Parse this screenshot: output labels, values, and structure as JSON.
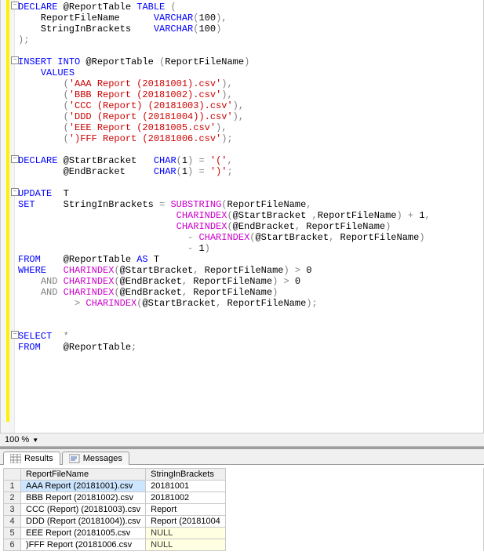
{
  "zoom": {
    "value": "100 %"
  },
  "tabs": {
    "results": "Results",
    "messages": "Messages"
  },
  "fold_glyph": "−",
  "code": {
    "l1": {
      "a": "DECLARE",
      "b": " @ReportTable ",
      "c": "TABLE",
      "d": " ",
      "e": "("
    },
    "l2": {
      "a": "    ReportFileName      ",
      "b": "VARCHAR",
      "c": "(",
      "d": "100",
      "e": "),"
    },
    "l3": {
      "a": "    StringInBrackets    ",
      "b": "VARCHAR",
      "c": "(",
      "d": "100",
      "e": ")"
    },
    "l4": {
      "a": ");"
    },
    "l5": "",
    "l6": {
      "a": "INSERT",
      "b": " ",
      "c": "INTO",
      "d": " @ReportTable ",
      "e": "(",
      "f": "ReportFileName",
      "g": ")"
    },
    "l7": {
      "a": "    ",
      "b": "VALUES"
    },
    "l8": {
      "a": "        ",
      "b": "(",
      "c": "'AAA Report (20181001).csv'",
      "d": "),"
    },
    "l9": {
      "a": "        ",
      "b": "(",
      "c": "'BBB Report (20181002).csv'",
      "d": "),"
    },
    "l10": {
      "a": "        ",
      "b": "(",
      "c": "'CCC (Report) (20181003).csv'",
      "d": "),"
    },
    "l11": {
      "a": "        ",
      "b": "(",
      "c": "'DDD (Report (20181004)).csv'",
      "d": "),"
    },
    "l12": {
      "a": "        ",
      "b": "(",
      "c": "'EEE Report (20181005.csv'",
      "d": "),"
    },
    "l13": {
      "a": "        ",
      "b": "(",
      "c": "')FFF Report (20181006.csv'",
      "d": ");"
    },
    "l14": "",
    "l15": {
      "a": "DECLARE",
      "b": " @StartBracket   ",
      "c": "CHAR",
      "d": "(",
      "e": "1",
      "f": ")",
      "g": " ",
      "h": "=",
      "i": " ",
      "j": "'('",
      "k": ","
    },
    "l16": {
      "a": "        @EndBracket     ",
      "b": "CHAR",
      "c": "(",
      "d": "1",
      "e": ")",
      "f": " ",
      "g": "=",
      "h": " ",
      "i": "')'",
      "j": ";"
    },
    "l17": "",
    "l18": {
      "a": "UPDATE",
      "b": "  T"
    },
    "l19": {
      "a": "SET",
      "b": "     StringInBrackets ",
      "c": "=",
      "d": " ",
      "e": "SUBSTRING",
      "f": "(",
      "g": "ReportFileName",
      "h": ","
    },
    "l20": {
      "a": "                            ",
      "b": "CHARINDEX",
      "c": "(",
      "d": "@StartBracket ",
      "e": ",",
      "f": "ReportFileName",
      "g": ")",
      "h": " ",
      "i": "+",
      "j": " 1",
      "k": ","
    },
    "l21": {
      "a": "                            ",
      "b": "CHARINDEX",
      "c": "(",
      "d": "@EndBracket",
      "e": ",",
      "f": " ReportFileName",
      "g": ")"
    },
    "l22": {
      "a": "                              ",
      "b": "-",
      "c": " ",
      "d": "CHARINDEX",
      "e": "(",
      "f": "@StartBracket",
      "g": ",",
      "h": " ReportFileName",
      "i": ")"
    },
    "l23": {
      "a": "                              ",
      "b": "-",
      "c": " 1",
      "d": ")"
    },
    "l24": {
      "a": "FROM",
      "b": "    @ReportTable ",
      "c": "AS",
      "d": " T"
    },
    "l25": {
      "a": "WHERE",
      "b": "   ",
      "c": "CHARINDEX",
      "d": "(",
      "e": "@StartBracket",
      "f": ",",
      "g": " ReportFileName",
      "h": ")",
      "i": " ",
      "j": ">",
      "k": " 0"
    },
    "l26": {
      "a": "    ",
      "b": "AND",
      "c": " ",
      "d": "CHARINDEX",
      "e": "(",
      "f": "@EndBracket",
      "g": ",",
      "h": " ReportFileName",
      "i": ")",
      "j": " ",
      "k": ">",
      "l": " 0"
    },
    "l27": {
      "a": "    ",
      "b": "AND",
      "c": " ",
      "d": "CHARINDEX",
      "e": "(",
      "f": "@EndBracket",
      "g": ",",
      "h": " ReportFileName",
      "i": ")"
    },
    "l28": {
      "a": "          ",
      "b": ">",
      "c": " ",
      "d": "CHARINDEX",
      "e": "(",
      "f": "@StartBracket",
      "g": ",",
      "h": " ReportFileName",
      "i": ");"
    },
    "l29": "",
    "l30": "",
    "l31": {
      "a": "SELECT",
      "b": "  ",
      "c": "*"
    },
    "l32": {
      "a": "FROM",
      "b": "    @ReportTable",
      "c": ";"
    }
  },
  "results": {
    "columns": [
      "ReportFileName",
      "StringInBrackets"
    ],
    "rows": [
      {
        "n": "1",
        "c0": "AAA Report (20181001).csv",
        "c1": "20181001",
        "null1": false,
        "sel": true
      },
      {
        "n": "2",
        "c0": "BBB Report (20181002).csv",
        "c1": "20181002",
        "null1": false,
        "sel": false
      },
      {
        "n": "3",
        "c0": "CCC (Report) (20181003).csv",
        "c1": "Report",
        "null1": false,
        "sel": false
      },
      {
        "n": "4",
        "c0": "DDD (Report (20181004)).csv",
        "c1": "Report (20181004",
        "null1": false,
        "sel": false
      },
      {
        "n": "5",
        "c0": "EEE Report (20181005.csv",
        "c1": "NULL",
        "null1": true,
        "sel": false
      },
      {
        "n": "6",
        "c0": ")FFF Report (20181006.csv",
        "c1": "NULL",
        "null1": true,
        "sel": false
      }
    ]
  }
}
